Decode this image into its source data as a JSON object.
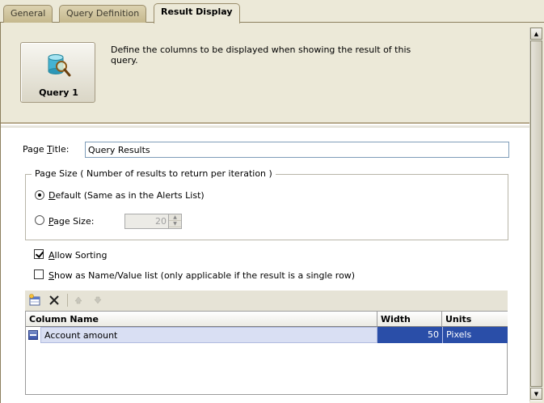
{
  "tabs": [
    {
      "label": "General"
    },
    {
      "label": "Query Definition"
    },
    {
      "label": "Result Display"
    }
  ],
  "header": {
    "query_name": "Query 1",
    "description": "Define the columns to be displayed when showing the result of this query."
  },
  "form": {
    "page_title_label": "Page Title:",
    "page_title_value": "Query Results",
    "page_size_group_label": "Page Size ( Number of results to return per iteration )",
    "default_option_label": "Default (Same as in the Alerts List)",
    "page_size_option_label": "Page Size:",
    "page_size_value": "20",
    "allow_sorting_label": "Allow Sorting",
    "allow_sorting_checked": true,
    "name_value_label": "Show as Name/Value list (only applicable if the result is a single row)",
    "name_value_checked": false
  },
  "table": {
    "headers": [
      "Column Name",
      "Width",
      "Units"
    ],
    "rows": [
      {
        "column_name": "Account amount",
        "width": "50",
        "units": "Pixels"
      }
    ]
  },
  "colors": {
    "selection": "#2a4ea8",
    "row_highlight": "#d9dff3"
  }
}
